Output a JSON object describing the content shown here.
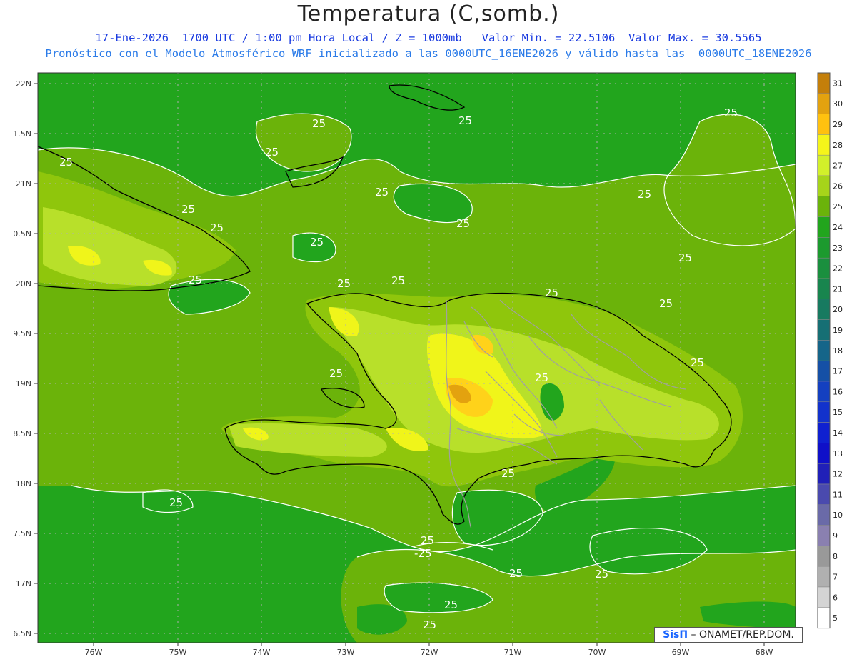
{
  "header": {
    "title": "Temperatura (C,somb.)",
    "subtitle_line1": "17-Ene-2026  1700 UTC / 1:00 pm Hora Local / Z = 1000mb   Valor Min. = 22.5106  Valor Max. = 30.5565",
    "subtitle_line2": "Pronóstico con el Modelo Atmosférico WRF inicializado a las 0000UTC_16ENE2026 y válido hasta las  0000UTC_18ENE2026"
  },
  "map": {
    "lat_ticks": [
      "22N",
      "1.5N",
      "21N",
      "0.5N",
      "20N",
      "9.5N",
      "19N",
      "8.5N",
      "18N",
      "7.5N",
      "17N",
      "6.5N"
    ],
    "lon_ticks": [
      "76W",
      "75W",
      "74W",
      "73W",
      "72W",
      "71W",
      "70W",
      "69W",
      "68W"
    ],
    "contour_labels": [
      "25",
      "25",
      "25",
      "25",
      "25",
      "25",
      "25",
      "25",
      "25",
      "25",
      "25",
      "25",
      "25",
      "25",
      "25",
      "25",
      "25",
      "25",
      "25",
      "25",
      "-25",
      "25",
      "25",
      "25",
      "25",
      "25",
      "25",
      "25"
    ],
    "colors": {
      "sea_24": "#22a51d",
      "band_25": "#6bb30a",
      "band_26": "#8fc60c",
      "band_27": "#b8e02a",
      "band_28": "#f0f51a",
      "band_29": "#ffd21a",
      "band_30": "#e3a20f",
      "band_31": "#c47f0a",
      "coast": "#000000",
      "borders": "#a0a0a0",
      "contour": "#ffffff"
    }
  },
  "colorbar": {
    "labels": [
      "31",
      "30",
      "29",
      "28",
      "27",
      "26",
      "25",
      "24",
      "23",
      "22",
      "21",
      "20",
      "19",
      "18",
      "17",
      "16",
      "15",
      "14",
      "13",
      "12",
      "11",
      "10",
      "9",
      "8",
      "7",
      "6",
      "5"
    ],
    "colors": [
      "#c47f0a",
      "#e3a20f",
      "#ffc10f",
      "#f5f51a",
      "#d2f02a",
      "#a6d41a",
      "#6bb30a",
      "#22a51d",
      "#1c9a2e",
      "#1a8f3e",
      "#18854e",
      "#177a60",
      "#166f74",
      "#156589",
      "#1550a6",
      "#1440c0",
      "#1232cc",
      "#0f20d0",
      "#0f10c8",
      "#2020b8",
      "#4a4aae",
      "#6a6aa8",
      "#8a80b0",
      "#999999",
      "#b0b0b0",
      "#d4d4d4",
      "#ffffff"
    ]
  },
  "footer": {
    "credit_logo": "SisΠ",
    "credit_text": "– ONAMET/REP.DOM."
  }
}
